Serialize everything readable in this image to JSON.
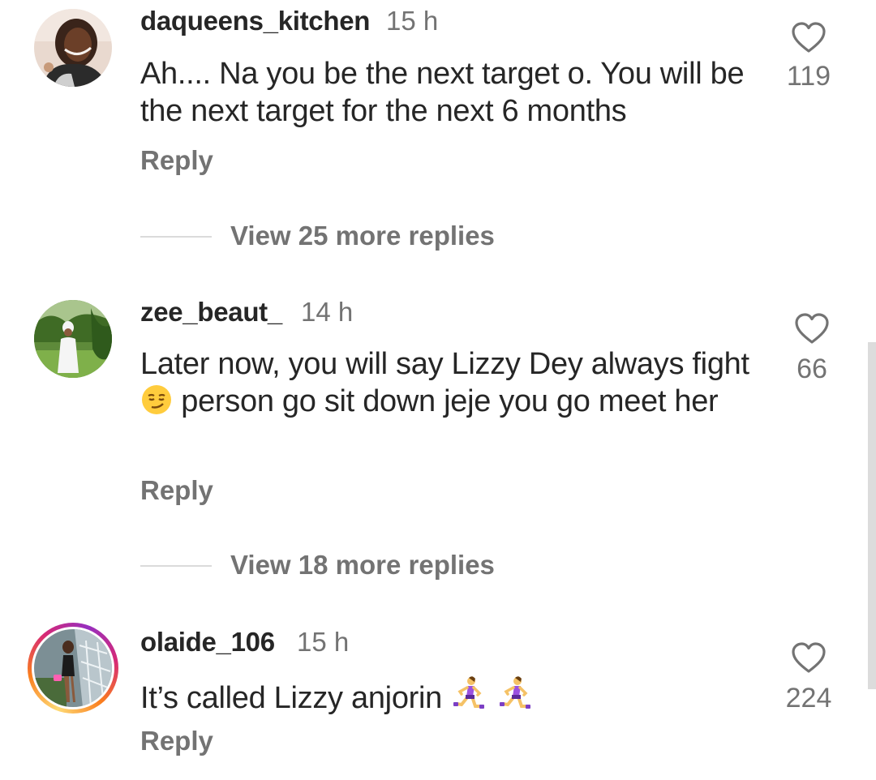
{
  "comments": [
    {
      "username": "daqueens_kitchen",
      "time": "15 h",
      "text": "Ah.... Na you be the next target o. You will be the next target for the next 6 months",
      "reply_label": "Reply",
      "likes": "119",
      "view_more": "View 25 more replies"
    },
    {
      "username": "zee_beaut_",
      "time": "14 h",
      "text_parts": [
        "Later now, you will say Lizzy Dey always fight",
        "person go sit down jeje you go meet her"
      ],
      "emoji": "smirking-face",
      "reply_label": "Reply",
      "likes": "66",
      "view_more": "View 18 more replies"
    },
    {
      "username": "olaide_106",
      "time": "15 h",
      "text": "It’s called Lizzy anjorin",
      "emoji": "woman-running",
      "reply_label": "Reply",
      "likes": "224"
    }
  ],
  "colors": {
    "text": "#262626",
    "secondary": "#737373",
    "divider": "#dbdbdb",
    "story_ring": [
      "#feda75",
      "#fa7e1e",
      "#d62976",
      "#962fbf"
    ]
  },
  "icons": [
    "heart-icon",
    "smirking-face-emoji",
    "woman-running-emoji"
  ]
}
